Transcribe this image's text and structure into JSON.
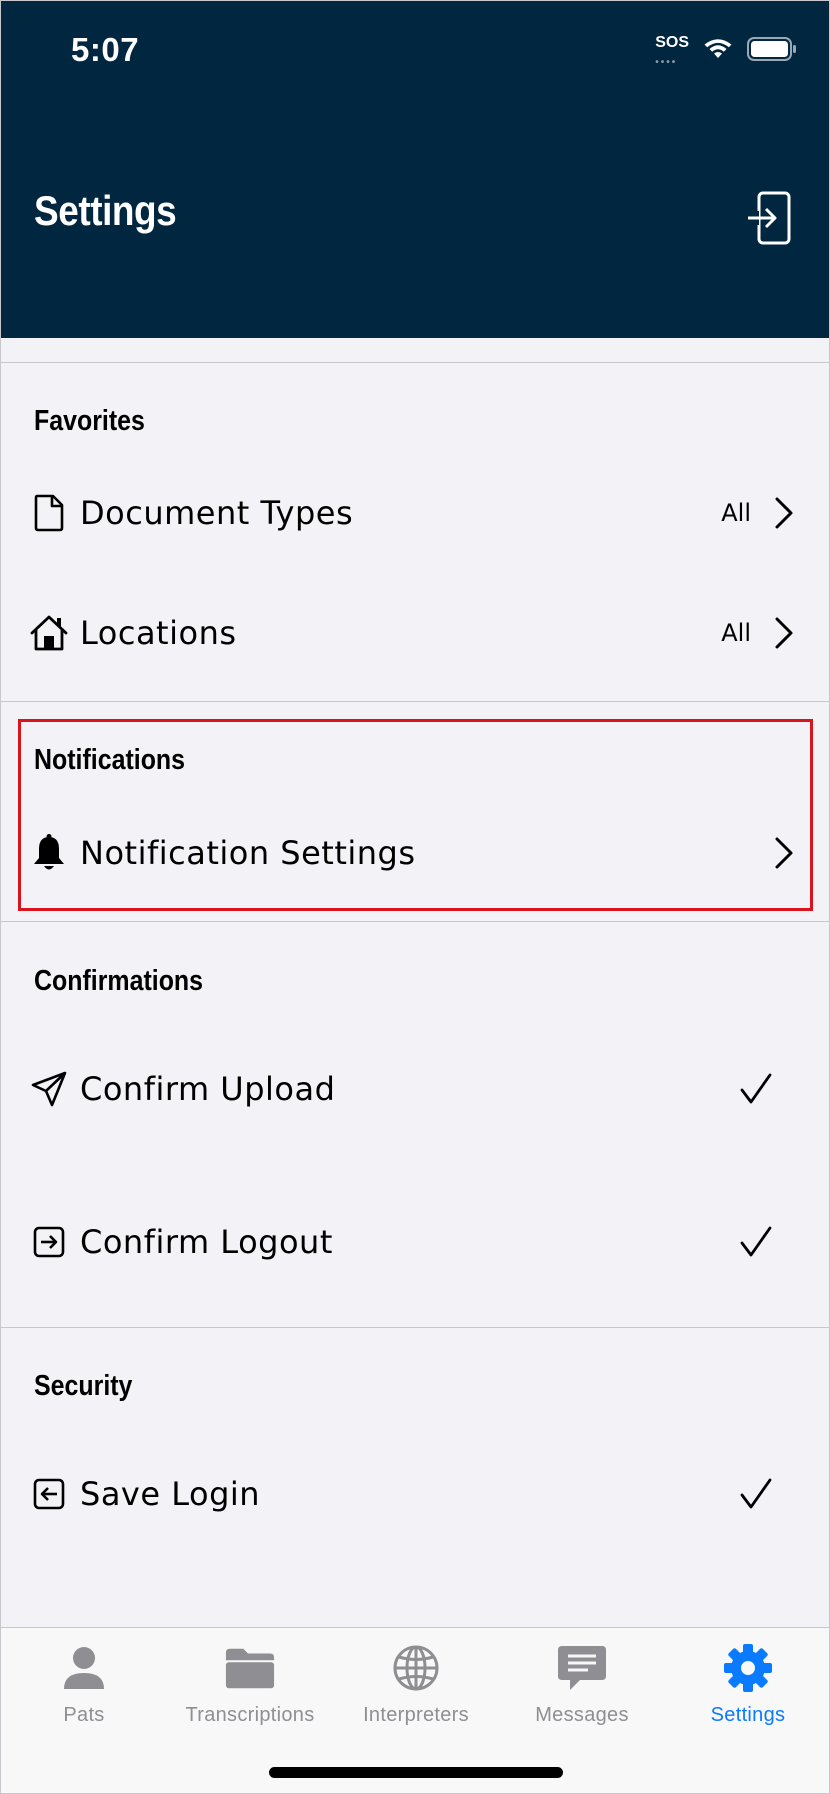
{
  "status_bar": {
    "time": "5:07",
    "sos": "SOS"
  },
  "header": {
    "title": "Settings",
    "logout_icon": "logout-icon"
  },
  "sections": [
    {
      "title": "Favorites",
      "items": [
        {
          "label": "Document Types",
          "value": "All",
          "icon": "document-icon"
        },
        {
          "label": "Locations",
          "value": "All",
          "icon": "home-icon"
        }
      ]
    },
    {
      "title": "Notifications",
      "items": [
        {
          "label": "Notification Settings",
          "icon": "bell-icon"
        }
      ]
    },
    {
      "title": "Confirmations",
      "items": [
        {
          "label": "Confirm Upload",
          "checked": true,
          "icon": "send-icon"
        },
        {
          "label": "Confirm Logout",
          "checked": true,
          "icon": "logout-square-icon"
        }
      ]
    },
    {
      "title": "Security",
      "items": [
        {
          "label": "Save Login",
          "checked": true,
          "icon": "login-square-icon"
        }
      ]
    }
  ],
  "tabbar": {
    "tabs": [
      {
        "label": "Pats",
        "icon": "person-icon",
        "active": false
      },
      {
        "label": "Transcriptions",
        "icon": "folder-icon",
        "active": false
      },
      {
        "label": "Interpreters",
        "icon": "globe-icon",
        "active": false
      },
      {
        "label": "Messages",
        "icon": "message-icon",
        "active": false
      },
      {
        "label": "Settings",
        "icon": "gear-icon",
        "active": true
      }
    ]
  },
  "colors": {
    "header_bg": "#002640",
    "list_bg": "#f2f2f7",
    "accent": "#0a7aff",
    "highlight": "#d9141c",
    "inactive_tab": "#8e8e93"
  }
}
